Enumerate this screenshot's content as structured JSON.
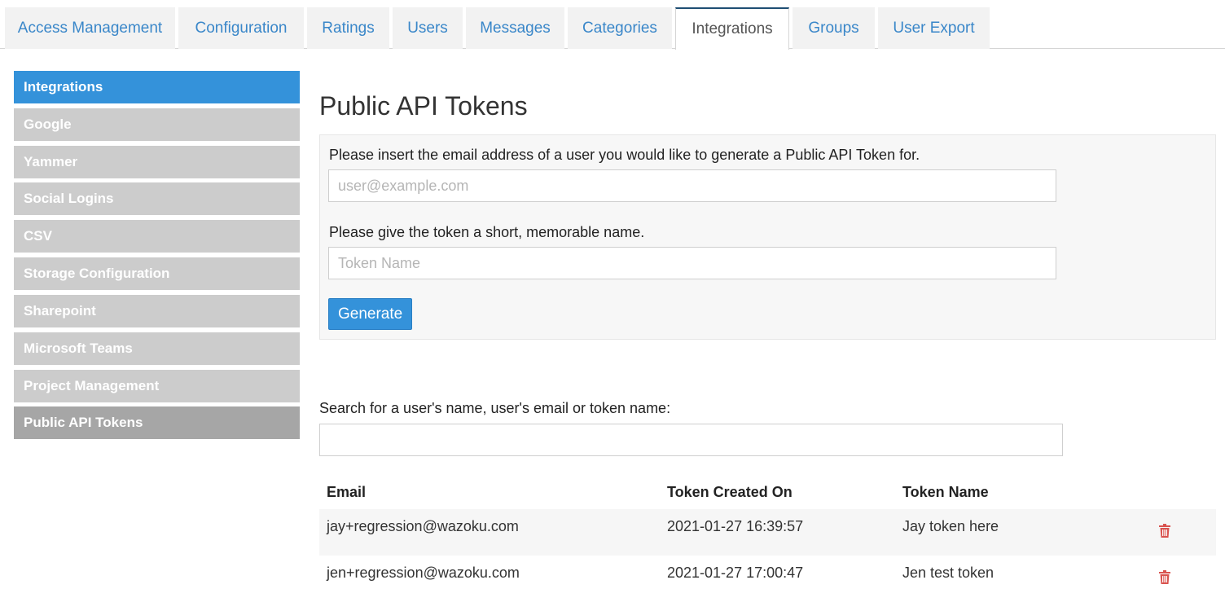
{
  "tabs": [
    {
      "label": "Access Management"
    },
    {
      "label": "Configuration"
    },
    {
      "label": "Ratings"
    },
    {
      "label": "Users"
    },
    {
      "label": "Messages"
    },
    {
      "label": "Categories"
    },
    {
      "label": "Integrations",
      "active": true
    },
    {
      "label": "Groups"
    },
    {
      "label": "User Export"
    }
  ],
  "sidebar": {
    "items": [
      {
        "label": "Integrations"
      },
      {
        "label": "Google"
      },
      {
        "label": "Yammer"
      },
      {
        "label": "Social Logins"
      },
      {
        "label": "CSV"
      },
      {
        "label": "Storage Configuration"
      },
      {
        "label": "Sharepoint"
      },
      {
        "label": "Microsoft Teams"
      },
      {
        "label": "Project Management"
      },
      {
        "label": "Public API Tokens"
      }
    ]
  },
  "main": {
    "title": "Public API Tokens",
    "form": {
      "email_label": "Please insert the email address of a user you would like to generate a Public API Token for.",
      "email_placeholder": "user@example.com",
      "name_label": "Please give the token a short, memorable name.",
      "name_placeholder": "Token Name",
      "generate_label": "Generate"
    },
    "search": {
      "label": "Search for a user's name, user's email or token name:",
      "value": ""
    },
    "table": {
      "headers": {
        "email": "Email",
        "created": "Token Created On",
        "name": "Token Name"
      },
      "rows": [
        {
          "email": "jay+regression@wazoku.com",
          "created": "2021-01-27 16:39:57",
          "name": "Jay token here"
        },
        {
          "email": "jen+regression@wazoku.com",
          "created": "2021-01-27 17:00:47",
          "name": "Jen test token"
        }
      ]
    }
  },
  "colors": {
    "accent": "#3492da",
    "link": "#3a87c9",
    "delete": "#d9534f"
  },
  "icons": {
    "delete": "trash-icon"
  }
}
